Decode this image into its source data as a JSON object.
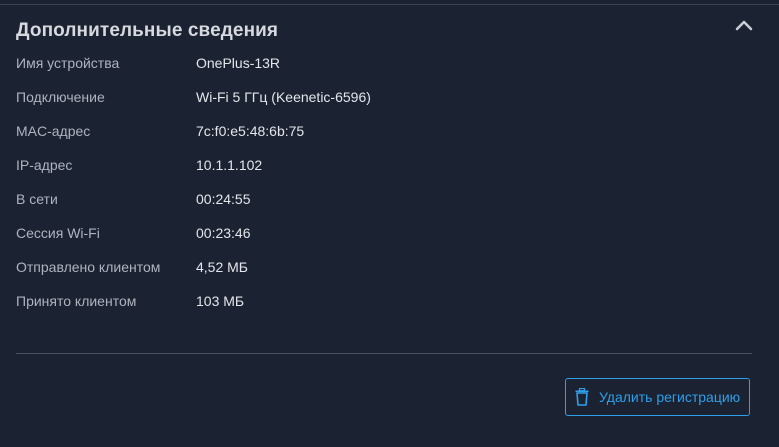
{
  "section": {
    "title": "Дополнительные сведения",
    "toggle_icon": "chevron-up-icon"
  },
  "details": [
    {
      "label": "Имя устройства",
      "value": "OnePlus-13R"
    },
    {
      "label": "Подключение",
      "value": "Wi-Fi 5 ГГц (Keenetic-6596)"
    },
    {
      "label": "MAC-адрес",
      "value": "7c:f0:e5:48:6b:75"
    },
    {
      "label": "IP-адрес",
      "value": "10.1.1.102"
    },
    {
      "label": "В сети",
      "value": "00:24:55"
    },
    {
      "label": "Сессия Wi-Fi",
      "value": "00:23:46"
    },
    {
      "label": "Отправлено клиентом",
      "value": "4,52 МБ"
    },
    {
      "label": "Принято клиентом",
      "value": "103 МБ"
    }
  ],
  "actions": {
    "unregister_label": "Удалить регистрацию",
    "unregister_icon": "trash-icon"
  },
  "colors": {
    "background": "#1b2232",
    "accent": "#2e9fe8",
    "label": "#aeb3bd",
    "value": "#e3e6ea",
    "title": "#d6d9de"
  }
}
